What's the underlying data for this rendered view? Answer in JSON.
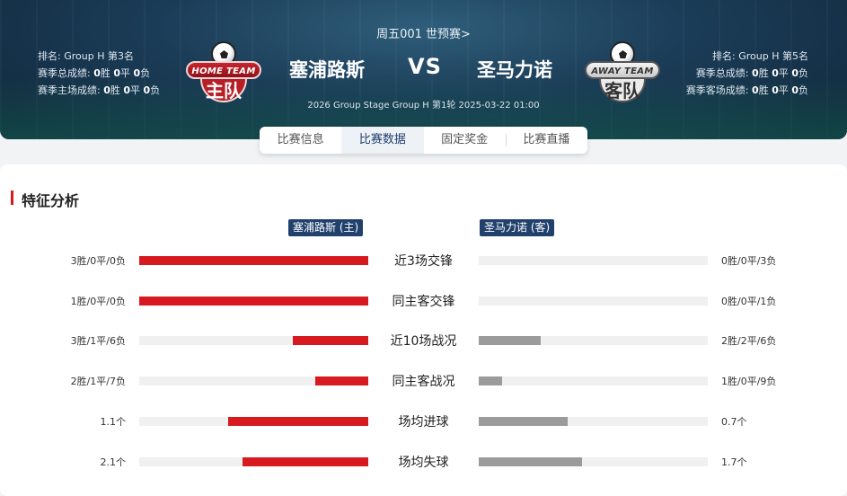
{
  "header": {
    "match_link": "周五001 世预赛>",
    "vs": "VS",
    "match_info": "2026 Group Stage Group H 第1轮 2025-03-22 01:00",
    "home": {
      "name": "塞浦路斯",
      "rank": "排名: Group H 第3名",
      "season_record_label": "赛季总成绩:",
      "season_record": {
        "w": "0",
        "d": "0",
        "l": "0"
      },
      "venue_record_label": "赛季主场成绩:",
      "venue_record": {
        "w": "0",
        "d": "0",
        "l": "0"
      },
      "logo_text": "HOME TEAM",
      "logo_cn": "主队"
    },
    "away": {
      "name": "圣马力诺",
      "rank": "排名: Group H 第5名",
      "season_record_label": "赛季总成绩:",
      "season_record": {
        "w": "0",
        "d": "0",
        "l": "0"
      },
      "venue_record_label": "赛季客场成绩:",
      "venue_record": {
        "w": "0",
        "d": "0",
        "l": "0"
      },
      "logo_text": "AWAY TEAM",
      "logo_cn": "客队"
    },
    "record_units": {
      "w": "胜",
      "d": "平",
      "l": "负"
    }
  },
  "tabs": [
    {
      "label": "比赛信息",
      "active": false
    },
    {
      "label": "比赛数据",
      "active": true
    },
    {
      "label": "固定奖金",
      "active": false
    },
    {
      "label": "比赛直播",
      "active": false
    }
  ],
  "analysis": {
    "title": "特征分析",
    "home_tag": "塞浦路斯 (主)",
    "away_tag": "圣马力诺 (客)",
    "rows": [
      {
        "metric": "近3场交锋",
        "home_label": "3胜/0平/0负",
        "home_ratio": 1.0,
        "away_label": "0胜/0平/3负",
        "away_ratio": 0.0
      },
      {
        "metric": "同主客交锋",
        "home_label": "1胜/0平/0负",
        "home_ratio": 1.0,
        "away_label": "0胜/0平/1负",
        "away_ratio": 0.0
      },
      {
        "metric": "近10场战况",
        "home_label": "3胜/1平/6负",
        "home_ratio": 0.33,
        "away_label": "2胜/2平/6负",
        "away_ratio": 0.27
      },
      {
        "metric": "同主客战况",
        "home_label": "2胜/1平/7负",
        "home_ratio": 0.23,
        "away_label": "1胜/0平/9负",
        "away_ratio": 0.1
      },
      {
        "metric": "场均进球",
        "home_label": "1.1个",
        "home_ratio": 0.61,
        "away_label": "0.7个",
        "away_ratio": 0.39
      },
      {
        "metric": "场均失球",
        "home_label": "2.1个",
        "home_ratio": 0.55,
        "away_label": "1.7个",
        "away_ratio": 0.45
      }
    ]
  },
  "colors": {
    "home_bar": "#d71920",
    "away_bar": "#9b9b9b",
    "tag_bg": "#21416d",
    "accent": "#d71920"
  }
}
